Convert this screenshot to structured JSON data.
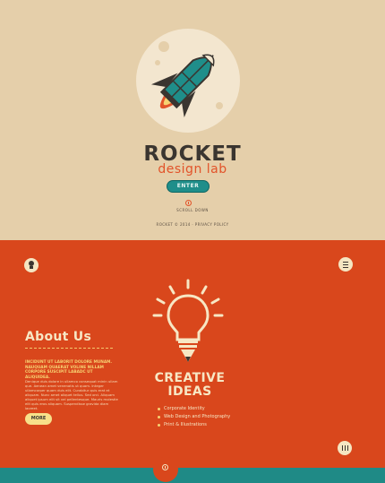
{
  "hero": {
    "brand": "ROCKET",
    "tagline": "design lab",
    "enter_label": "ENTER",
    "scroll_label": "SCROLL DOWN",
    "copyright": "ROCKET © 2014 · PRIVACY POLICY"
  },
  "about": {
    "title": "About Us",
    "lead": "INCIDUNT UT LABORIT DOLORE MUNAM. NAUQUAM QUAERAT VOLINE NILLAM CORPORE SUSCIPIT LABADC UT ALIQUIDEA.",
    "body": "Denique duis dolore in ullamco consequat minin ullam que. Aenean amet venenatis ut quam. Integer ullamcorper quam duis elit. Curabitur quis erat et aliquam. Nunc amet aliquet tellus. Sed orci. Aliquam aliquet ipsum elit sit vel pellentesque. Mauris molestie elit quis eros aliquam. Suspendisse gravida diam laoreet.",
    "more_label": "MORE"
  },
  "creative": {
    "title_line1": "CREATIVE",
    "title_line2": "IDEAS",
    "services": [
      "Corporate Identity",
      "Web Design and Photography",
      "Print & Illustrations"
    ]
  },
  "colors": {
    "hero_bg": "#e5cfaa",
    "orange": "#d9471c",
    "teal": "#1f8e8a",
    "cream": "#f7e7c4",
    "dark": "#3a3530"
  },
  "icons": {
    "logo": "rocket-icon",
    "section_left": "lightbulb-icon",
    "section_right": "menu-icon",
    "section_right_bottom": "columns-icon",
    "footer": "scroll-icon"
  }
}
